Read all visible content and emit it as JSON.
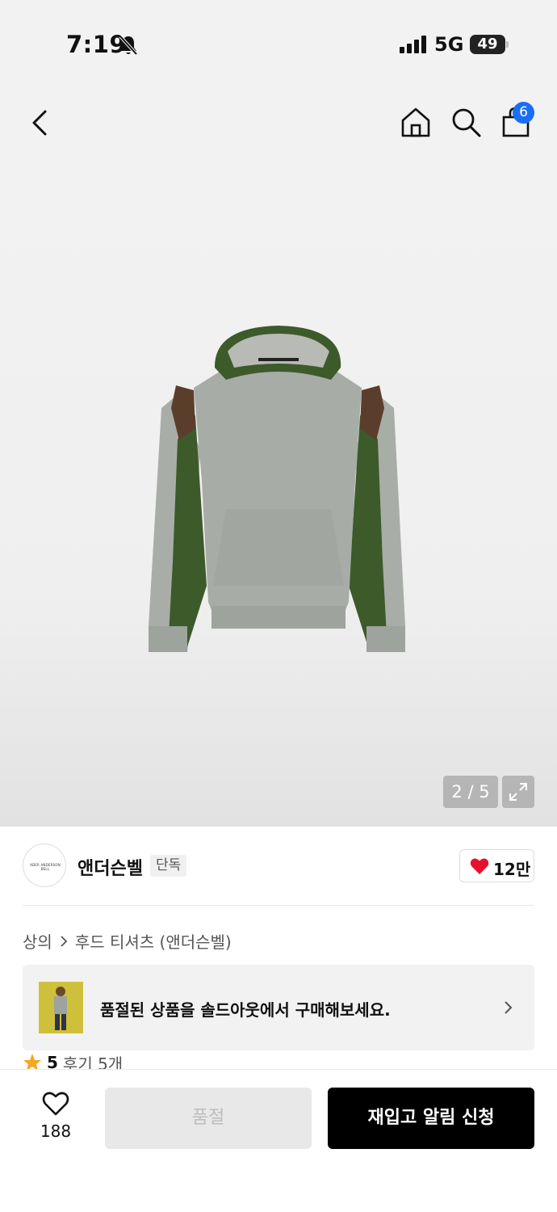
{
  "status_bar": {
    "time": "7:19",
    "network": "5G",
    "battery": "49",
    "icons": [
      "bell-slash-icon",
      "signal-icon"
    ]
  },
  "top_nav": {
    "icons": [
      "back-icon",
      "home-icon",
      "search-icon",
      "bag-icon"
    ],
    "cart_count": "6"
  },
  "gallery": {
    "counter": "2 / 5",
    "expand_icon": "expand-icon"
  },
  "brand": {
    "logo_text": "ADER ANDERSON BELL",
    "name": "앤더슨벨",
    "tag": "단독",
    "likes": "12만",
    "heart_color": "#e8112d"
  },
  "breadcrumb": {
    "category": "상의",
    "subcategory": "후드 티셔츠 (앤더슨벨)"
  },
  "banner": {
    "text": "품절된 상품을 솔드아웃에서 구매해보세요."
  },
  "rating": {
    "score": "5",
    "reviews": "후기 5개",
    "star_color": "#f5a623"
  },
  "bottom_bar": {
    "wish_count": "188",
    "soldout_label": "품절",
    "restock_label": "재입고 알림 신청"
  }
}
